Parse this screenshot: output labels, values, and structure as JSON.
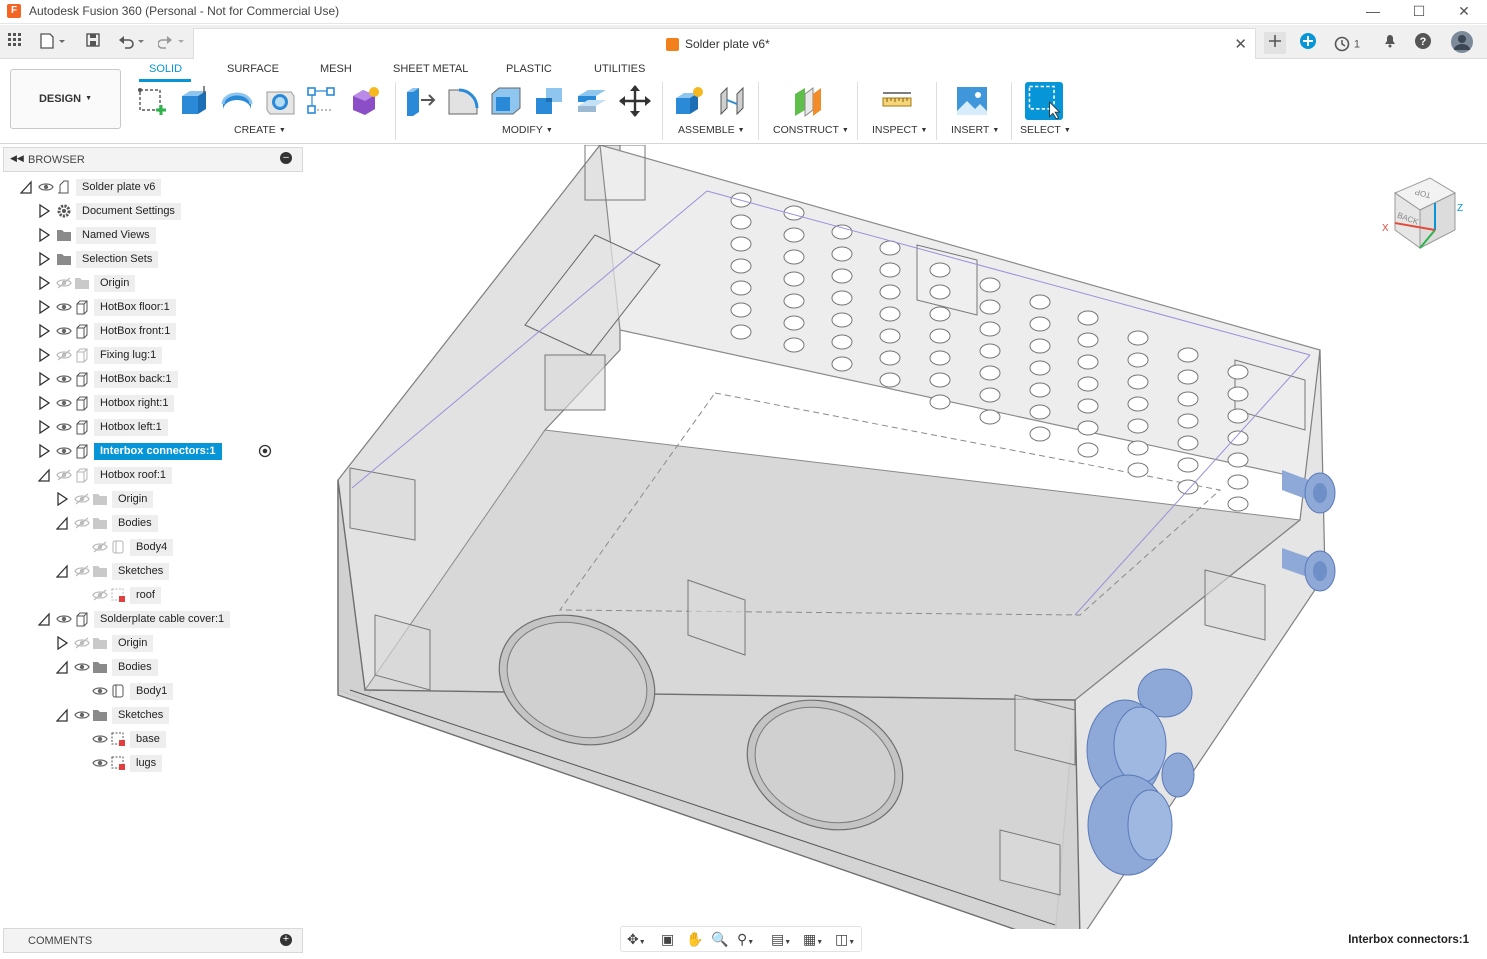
{
  "window": {
    "title": "Autodesk Fusion 360 (Personal - Not for Commercial Use)",
    "app_icon_letter": "F",
    "minimize_glyph": "—",
    "maximize_glyph": "☐",
    "close_glyph": "✕"
  },
  "document_tab": {
    "name": "Solder plate v6*",
    "close_glyph": "✕"
  },
  "header_right": {
    "jobs_count": "1"
  },
  "ribbon": {
    "workspace_label": "DESIGN",
    "tabs": [
      {
        "label": "SOLID",
        "active": true
      },
      {
        "label": "SURFACE",
        "active": false
      },
      {
        "label": "MESH",
        "active": false
      },
      {
        "label": "SHEET METAL",
        "active": false
      },
      {
        "label": "PLASTIC",
        "active": false
      },
      {
        "label": "UTILITIES",
        "active": false
      }
    ],
    "groups": [
      "CREATE",
      "MODIFY",
      "ASSEMBLE",
      "CONSTRUCT",
      "INSPECT",
      "INSERT",
      "SELECT"
    ]
  },
  "browser": {
    "title": "BROWSER",
    "nodes": [
      {
        "label": "Solder plate v6",
        "expanded": true,
        "visible": true,
        "icon": "document-icon"
      },
      {
        "label": "Document Settings",
        "expanded": false,
        "icon": "gear-icon"
      },
      {
        "label": "Named Views",
        "expanded": false,
        "icon": "folder-icon"
      },
      {
        "label": "Selection Sets",
        "expanded": false,
        "icon": "folder-icon"
      },
      {
        "label": "Origin",
        "expanded": false,
        "visible": false,
        "icon": "folder-icon"
      },
      {
        "label": "HotBox floor:1",
        "expanded": false,
        "visible": true,
        "icon": "component-icon"
      },
      {
        "label": "HotBox front:1",
        "expanded": false,
        "visible": true,
        "icon": "component-icon"
      },
      {
        "label": "Fixing lug:1",
        "expanded": false,
        "visible": false,
        "icon": "component-icon"
      },
      {
        "label": "HotBox back:1",
        "expanded": false,
        "visible": true,
        "icon": "component-icon"
      },
      {
        "label": "Hotbox right:1",
        "expanded": false,
        "visible": true,
        "icon": "component-icon"
      },
      {
        "label": "Hotbox left:1",
        "expanded": false,
        "visible": true,
        "icon": "component-icon"
      },
      {
        "label": "Interbox connectors:1",
        "expanded": false,
        "visible": true,
        "icon": "component-icon",
        "selected": true
      },
      {
        "label": "Hotbox roof:1",
        "expanded": true,
        "visible": false,
        "icon": "component-icon"
      },
      {
        "label": "Origin",
        "expanded": false,
        "visible": false,
        "icon": "folder-icon"
      },
      {
        "label": "Bodies",
        "expanded": true,
        "visible": false,
        "icon": "folder-icon"
      },
      {
        "label": "Body4",
        "visible": false,
        "icon": "body-icon"
      },
      {
        "label": "Sketches",
        "expanded": true,
        "visible": false,
        "icon": "folder-icon"
      },
      {
        "label": "roof",
        "visible": false,
        "icon": "sketch-icon"
      },
      {
        "label": "Solderplate cable cover:1",
        "expanded": true,
        "visible": true,
        "icon": "component-icon"
      },
      {
        "label": "Origin",
        "expanded": false,
        "visible": false,
        "icon": "folder-icon"
      },
      {
        "label": "Bodies",
        "expanded": true,
        "visible": true,
        "icon": "folder-icon"
      },
      {
        "label": "Body1",
        "visible": true,
        "icon": "body-icon"
      },
      {
        "label": "Sketches",
        "expanded": true,
        "visible": true,
        "icon": "folder-icon"
      },
      {
        "label": "base",
        "visible": true,
        "icon": "sketch-icon"
      },
      {
        "label": "lugs",
        "visible": true,
        "icon": "sketch-icon"
      }
    ]
  },
  "comments": {
    "title": "COMMENTS"
  },
  "viewcube": {
    "top_label": "TOP",
    "back_label": "BACK",
    "x_label": "X",
    "z_label": "Z"
  },
  "status": {
    "selection": "Interbox connectors:1"
  },
  "colors": {
    "accent": "#0696d7",
    "connector": "#8ea9d8",
    "app_icon": "#f26522"
  }
}
